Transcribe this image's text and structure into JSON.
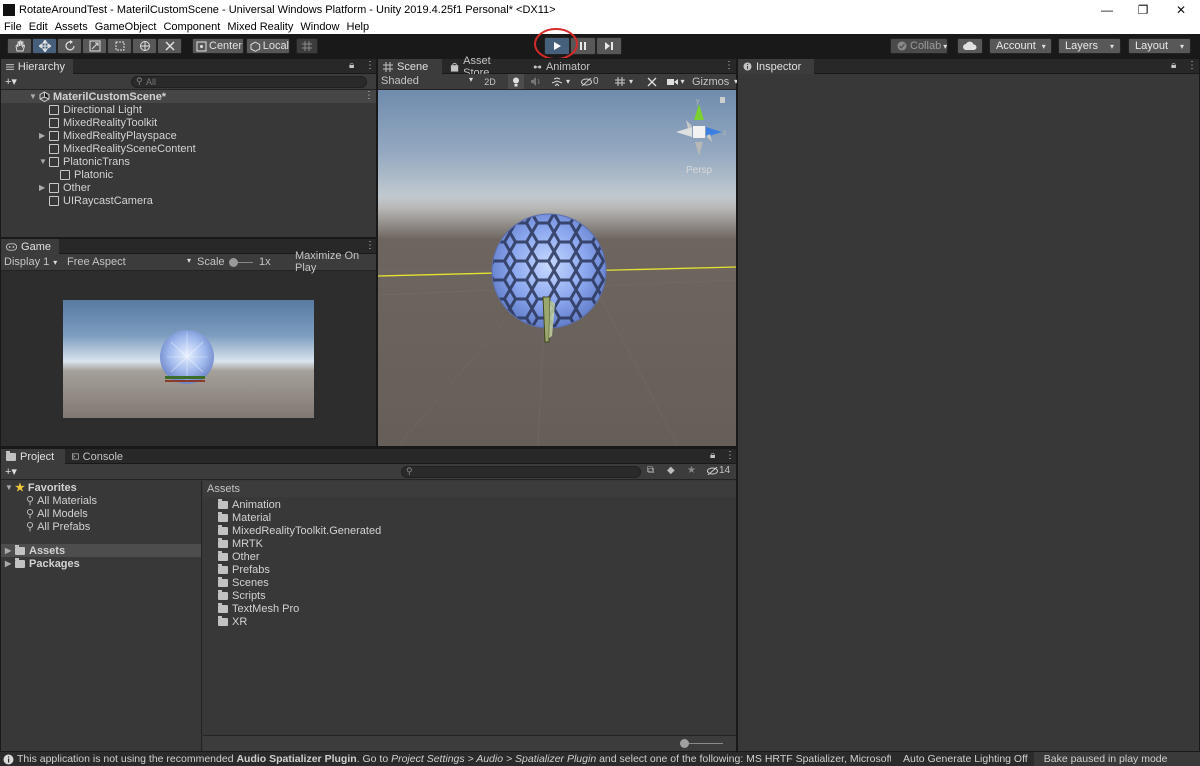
{
  "window": {
    "title": "RotateAroundTest - MaterilCustomScene - Universal Windows Platform - Unity 2019.4.25f1 Personal* <DX11>",
    "controls": [
      "—",
      "❐",
      "✕"
    ]
  },
  "menu": [
    "File",
    "Edit",
    "Assets",
    "GameObject",
    "Component",
    "Mixed Reality",
    "Window",
    "Help"
  ],
  "toolbar": {
    "pivot": "Center",
    "space": "Local",
    "collab": "Collab",
    "account": "Account",
    "layers": "Layers",
    "layout": "Layout",
    "play_icon": "play-icon",
    "pause_icon": "pause-icon",
    "step_icon": "step-icon"
  },
  "hierarchy": {
    "tab": "Hierarchy",
    "add": "+▾",
    "search_placeholder": "All",
    "scene": "MaterilCustomScene*",
    "items": [
      {
        "label": "Directional Light"
      },
      {
        "label": "MixedRealityToolkit"
      },
      {
        "label": "MixedRealityPlayspace"
      },
      {
        "label": "MixedRealitySceneContent"
      },
      {
        "label": "PlatonicTrans"
      },
      {
        "label": "Platonic"
      },
      {
        "label": "Other"
      },
      {
        "label": "UIRaycastCamera"
      }
    ]
  },
  "game": {
    "tab": "Game",
    "display": "Display 1",
    "aspect": "Free Aspect",
    "scale_label": "Scale",
    "scale_value": "1x",
    "maximize": "Maximize On Play"
  },
  "scene": {
    "tabs": [
      "Scene",
      "Asset Store",
      "Animator"
    ],
    "shading": "Shaded",
    "mode_2d": "2D",
    "hidden_count": "0",
    "gizmos": "Gizmos",
    "persp": "Persp",
    "gizmo_y": "y",
    "gizmo_z": "z"
  },
  "inspector": {
    "tab": "Inspector"
  },
  "project": {
    "tabs": [
      "Project",
      "Console"
    ],
    "add": "+▾",
    "hidden_count": "14",
    "favorites_label": "Favorites",
    "favorites": [
      "All Materials",
      "All Models",
      "All Prefabs"
    ],
    "roots": [
      "Assets",
      "Packages"
    ],
    "assets_header": "Assets",
    "folders": [
      "Animation",
      "Material",
      "MixedRealityToolkit.Generated",
      "MRTK",
      "Other",
      "Prefabs",
      "Scenes",
      "Scripts",
      "TextMesh Pro",
      "XR"
    ]
  },
  "status": {
    "message_prefix": "This application is not using the recommended ",
    "message_bold": "Audio Spatializer Plugin",
    "message_middle": ". Go to ",
    "message_path": "Project Settings > Audio > Spatializer Plugin",
    "message_suffix": " and select one of the following: MS HRTF Spatializer, Microsoft S",
    "auto_lighting": "Auto Generate Lighting Off",
    "bake": "Bake paused in play mode"
  },
  "colors": {
    "accent": "#46607c",
    "annotation_circle": "#d42a2a",
    "gizmo_y": "#7bd12f",
    "gizmo_z": "#3b7fe0",
    "selection_line": "#e4e431"
  }
}
